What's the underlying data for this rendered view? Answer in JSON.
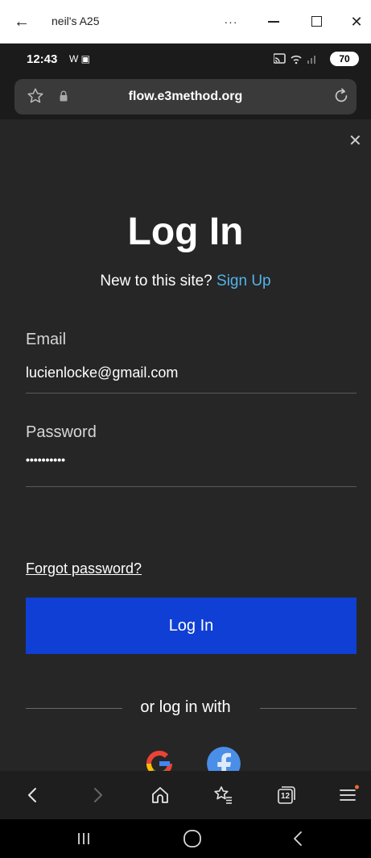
{
  "window": {
    "title": "neil's A25",
    "more_label": "···"
  },
  "status_bar": {
    "time": "12:43",
    "left_icons": "W ▣",
    "right_icons": "📶 ᯤ .ıl",
    "battery": "70"
  },
  "browser": {
    "url": "flow.e3method.org"
  },
  "login": {
    "heading": "Log In",
    "new_prompt": "New to this site?",
    "signup_link": "Sign Up",
    "email_label": "Email",
    "email_value": "lucienlocke@gmail.com",
    "password_label": "Password",
    "password_value": "••••••••••",
    "forgot_link": "Forgot password?",
    "login_button": "Log In",
    "or_text": "or log in with",
    "social": [
      "google",
      "facebook"
    ]
  },
  "toolbar": {
    "tabs_count": "12",
    "icons": [
      "back-icon",
      "forward-icon",
      "home-icon",
      "bookmarks-icon",
      "tabs-icon",
      "menu-icon"
    ]
  },
  "colors": {
    "page_bg": "#262626",
    "accent_button": "#0f3fd4",
    "link": "#52b3e8"
  }
}
